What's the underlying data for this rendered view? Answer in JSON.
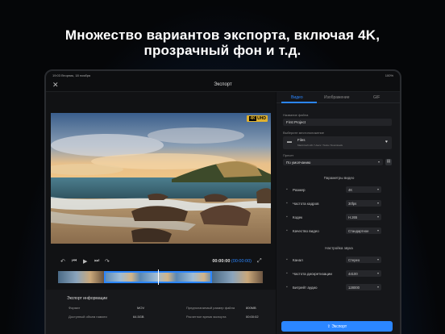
{
  "headline": {
    "line1": "Множество вариантов экспорта, включая 4K,",
    "line2": "прозрачный фон и т.д."
  },
  "status_bar": {
    "time": "19:03",
    "date": "Вторник, 18 ноября",
    "battery": "100%"
  },
  "nav": {
    "title": "Экспорт",
    "close_icon": "close-icon"
  },
  "preview": {
    "badge_4k": "4K",
    "badge_uhd": "UHD"
  },
  "playback": {
    "timecode_current": "00:00:00",
    "timecode_total": "(00:00:00)"
  },
  "info": {
    "title": "Экспорт информации",
    "rows": [
      {
        "label": "Формат",
        "value": "MOV",
        "label2": "Предполагаемый размер файла",
        "value2": "800MB"
      },
      {
        "label": "Доступный объем памяти",
        "value": "64.5GB",
        "label2": "Расчетное время экспорта",
        "value2": "00:00:02"
      }
    ]
  },
  "tabs": [
    {
      "label": "Видео",
      "active": true
    },
    {
      "label": "Изображение",
      "active": false
    },
    {
      "label": "GIF",
      "active": false
    }
  ],
  "file_name": {
    "label": "Название файла",
    "value": "First Project"
  },
  "location": {
    "label": "Выберите местоположение",
    "title": "Files",
    "path": "Macintosh HD / Users / Tesla / Downloads"
  },
  "preset": {
    "label": "Пресет",
    "value": "По умолчанию"
  },
  "video_params": {
    "title": "Параметры видео",
    "rows": [
      {
        "label": "Размер",
        "value": "4K"
      },
      {
        "label": "Частота кадров",
        "value": "30fps"
      },
      {
        "label": "Кодек",
        "value": "H.265"
      },
      {
        "label": "Качество видео",
        "value": "Стандартное"
      }
    ]
  },
  "audio_params": {
    "title": "Настройка звука",
    "rows": [
      {
        "label": "Канал",
        "value": "Стерео"
      },
      {
        "label": "Частота дискретизации",
        "value": "44100"
      },
      {
        "label": "Битрейт аудио",
        "value": "128000"
      }
    ]
  },
  "export_button": "Экспорт",
  "colors": {
    "accent": "#2b86ff",
    "panel": "#16171a",
    "badge": "#e0b12e"
  }
}
